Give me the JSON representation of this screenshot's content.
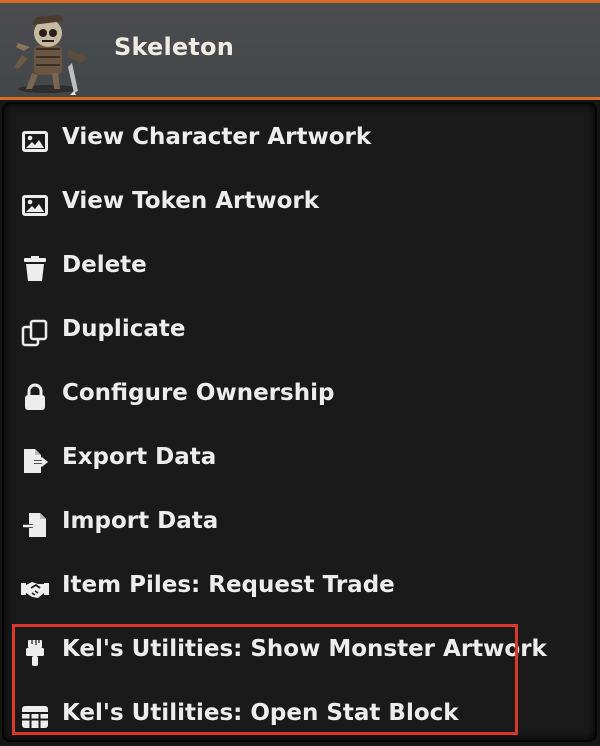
{
  "actor": {
    "name": "Skeleton",
    "portrait": "skeleton-token-icon"
  },
  "menu": {
    "items": [
      {
        "label": "View Character Artwork",
        "icon": "image-icon"
      },
      {
        "label": "View Token Artwork",
        "icon": "image-icon"
      },
      {
        "label": "Delete",
        "icon": "trash-icon"
      },
      {
        "label": "Duplicate",
        "icon": "copy-icon"
      },
      {
        "label": "Configure Ownership",
        "icon": "lock-icon"
      },
      {
        "label": "Export Data",
        "icon": "file-export-icon"
      },
      {
        "label": "Import Data",
        "icon": "file-import-icon"
      },
      {
        "label": "Item Piles: Request Trade",
        "icon": "handshake-icon"
      },
      {
        "label": "Kel's Utilities: Show Monster Artwork",
        "icon": "paintbrush-icon"
      },
      {
        "label": "Kel's Utilities: Open Stat Block",
        "icon": "table-icon"
      }
    ]
  },
  "colors": {
    "accent": "#d86a2a",
    "highlight": "#d9382b",
    "text": "#ededed"
  }
}
